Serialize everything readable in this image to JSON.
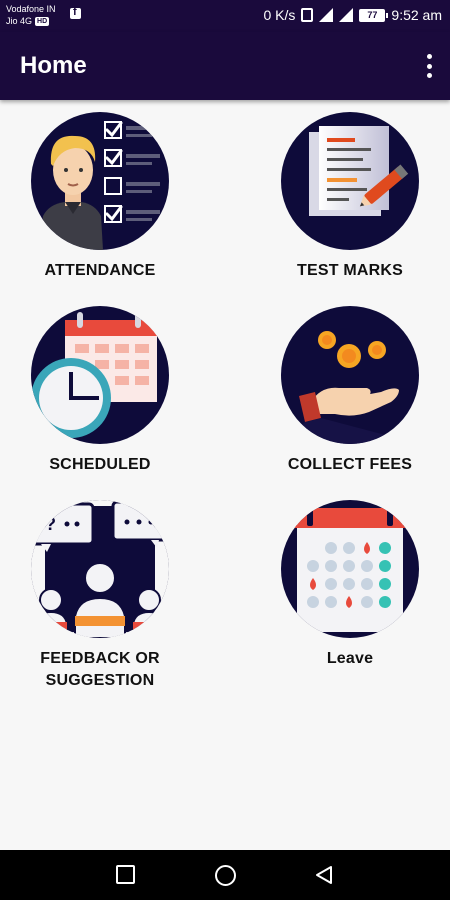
{
  "status_bar": {
    "carrier_line1": "Vodafone IN",
    "carrier_line2": "Jio 4G",
    "hd_badge": "HD",
    "network_speed": "0 K/s",
    "battery": "77",
    "time": "9:52 am"
  },
  "app_bar": {
    "title": "Home"
  },
  "tiles": [
    {
      "label": "ATTENDANCE"
    },
    {
      "label": "TEST MARKS"
    },
    {
      "label": "SCHEDULED"
    },
    {
      "label": "COLLECT FEES"
    },
    {
      "label_line1": "FEEDBACK OR",
      "label_line2": "SUGGESTION"
    },
    {
      "label": "Leave"
    }
  ],
  "colors": {
    "app_bar": "#1a0a3c",
    "icon_circle": "#0e0b3a",
    "background": "#f7f7f7"
  }
}
